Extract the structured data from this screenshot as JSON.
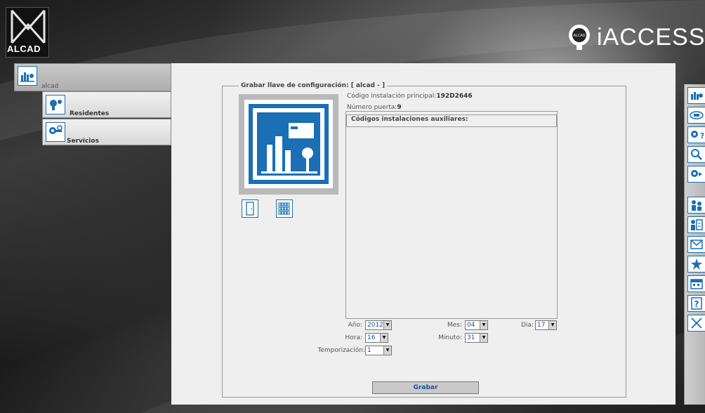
{
  "header": {
    "logo_text": "ALCAD",
    "brand_text": "iACCESS",
    "brand_seal_text": "ALCAD"
  },
  "sidebar": {
    "main_item": "alcad",
    "items": [
      {
        "label": "Residentes",
        "icon": "key-user-icon"
      },
      {
        "label": "Servicios",
        "icon": "key-gear-icon"
      }
    ]
  },
  "form": {
    "legend": "Grabar llave de configuración: [ alcad - ]",
    "install_code_label": "Código instalación principal:",
    "install_code_value": "192D2646",
    "door_label": "Número puerta:",
    "door_value": "9",
    "aux_header": "Códigos instalaciones auxiliares:",
    "year_label": "Año:",
    "year_value": "2012",
    "month_label": "Mes:",
    "month_value": "04",
    "day_label": "Dia:",
    "day_value": "17",
    "hour_label": "Hora:",
    "hour_value": "16",
    "minute_label": "Minuto:",
    "minute_value": "31",
    "timer_label": "Temporización:",
    "timer_value": "1",
    "submit_label": "Grabar"
  },
  "right_toolbar": [
    "building-chart-icon",
    "id-card-icon",
    "key-question-icon",
    "magnifier-icon",
    "key-arrow-icon",
    "users-icon",
    "user-list-icon",
    "envelope-icon",
    "star-icon",
    "calendar-icon",
    "help-icon",
    "close-icon"
  ],
  "colors": {
    "accent": "#1a6fb5",
    "panel_bg": "#efefef",
    "link_blue": "#1a4fa0"
  }
}
